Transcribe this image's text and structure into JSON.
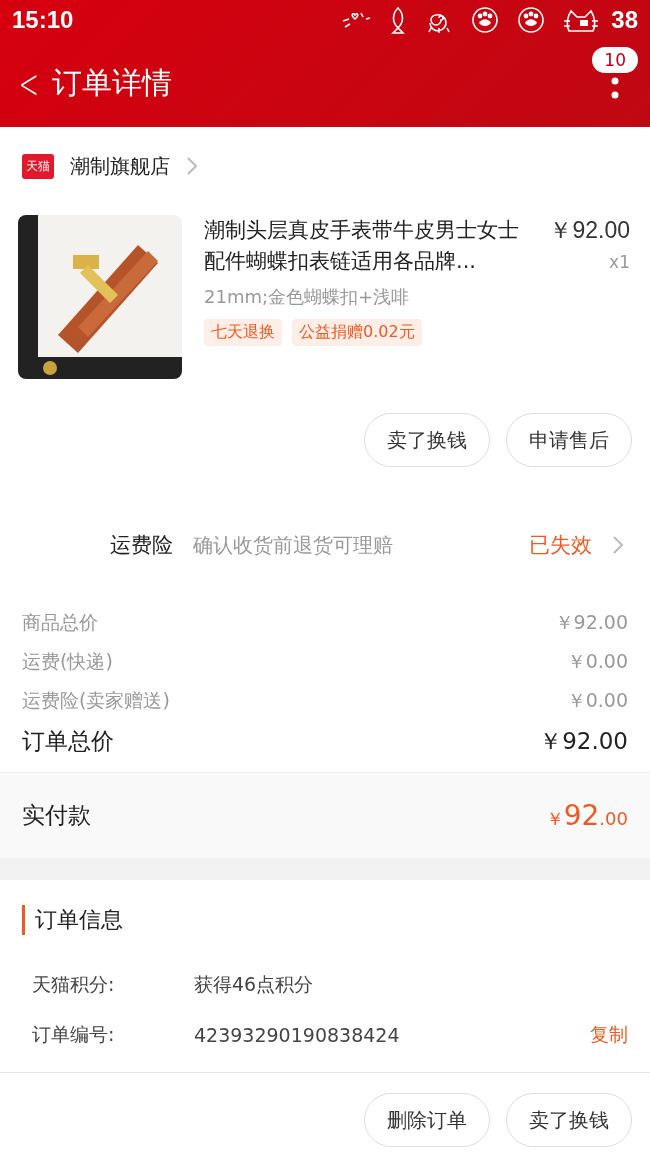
{
  "status_bar": {
    "time": "15:10",
    "battery": "38"
  },
  "app_bar": {
    "back": "<",
    "title": "订单详情",
    "badge": "10"
  },
  "shop": {
    "badge": "天猫",
    "name": "潮制旗舰店"
  },
  "product": {
    "kind": "picture",
    "title": "潮制头层真皮手表带牛皮男士女士配件蝴蝶扣表链适用各品牌...",
    "price": "￥92.00",
    "quantity": "x1",
    "sku": "21mm;金色蝴蝶扣+浅啡",
    "tags": [
      "七天退换",
      "公益捐赠0.02元"
    ]
  },
  "item_actions": [
    "卖了换钱",
    "申请售后"
  ],
  "insurance": {
    "label": "运费险",
    "description": "确认收货前退货可理赔",
    "status": "已失效"
  },
  "price_rows": [
    {
      "label": "商品总价",
      "value": "￥92.00",
      "kind": "minor"
    },
    {
      "label": "运费(快递)",
      "value": "￥0.00",
      "kind": "minor"
    },
    {
      "label": "运费险(卖家赠送)",
      "value": "￥0.00",
      "kind": "minor"
    },
    {
      "label": "订单总价",
      "value": "￥92.00",
      "kind": "total"
    }
  ],
  "paid": {
    "label": "实付款",
    "currency": "￥",
    "integer": "92",
    "decimal": ".00"
  },
  "order_info": {
    "title": "订单信息",
    "rows": [
      {
        "label": "天猫积分:",
        "value": "获得46点积分"
      },
      {
        "label": "订单编号:",
        "value": "42393290190838424",
        "action": "复制"
      }
    ]
  },
  "footer_actions": [
    "删除订单",
    "卖了换钱"
  ]
}
